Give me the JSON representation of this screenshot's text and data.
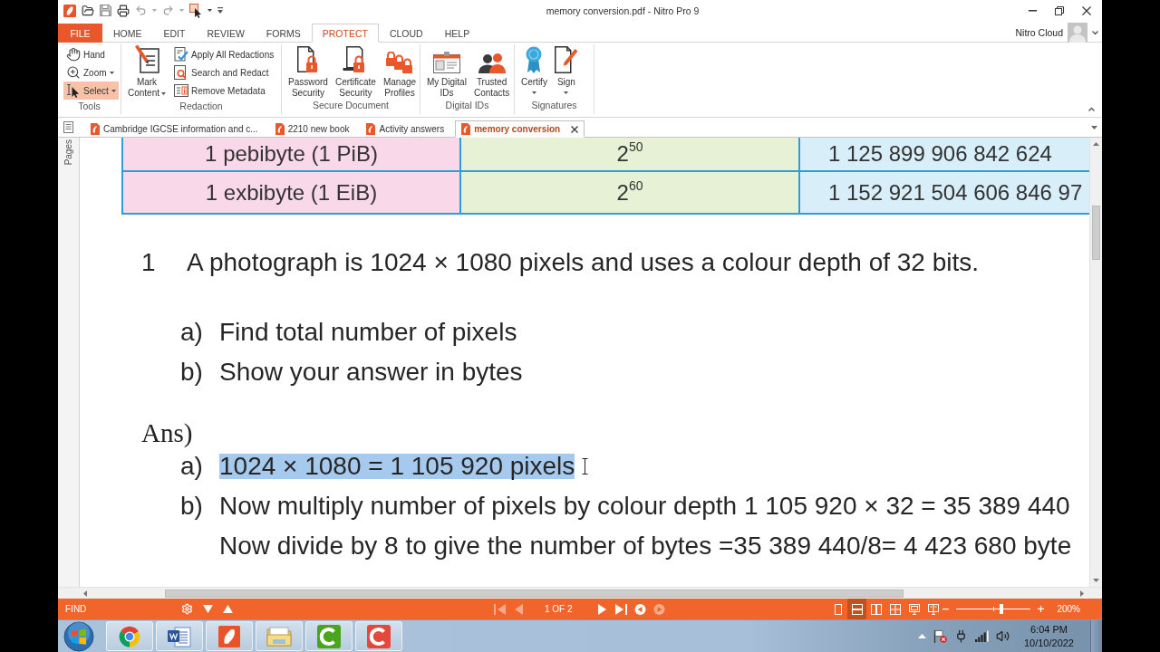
{
  "window": {
    "title": "memory conversion.pdf - Nitro Pro 9"
  },
  "ribbon_tabs": [
    {
      "label": "FILE",
      "kind": "file",
      "selected": false
    },
    {
      "label": "HOME",
      "kind": "tab",
      "selected": false
    },
    {
      "label": "EDIT",
      "kind": "tab",
      "selected": false
    },
    {
      "label": "REVIEW",
      "kind": "tab",
      "selected": false
    },
    {
      "label": "FORMS",
      "kind": "tab",
      "selected": false
    },
    {
      "label": "PROTECT",
      "kind": "tab",
      "selected": true
    },
    {
      "label": "CLOUD",
      "kind": "tab",
      "selected": false
    },
    {
      "label": "HELP",
      "kind": "tab",
      "selected": false
    }
  ],
  "account": {
    "label": "Nitro Cloud"
  },
  "ribbon_groups": [
    {
      "title": "Tools",
      "items": [
        {
          "label": "Hand",
          "kind": "small",
          "dropdown": false,
          "selected": false
        },
        {
          "label": "Zoom",
          "kind": "small",
          "dropdown": true,
          "selected": false
        },
        {
          "label": "Select",
          "kind": "small",
          "dropdown": true,
          "selected": true
        }
      ]
    },
    {
      "title": "Redaction",
      "items": [
        {
          "label": "Mark\nContent",
          "kind": "large",
          "dropdown": true
        },
        {
          "label": "Apply All Redactions",
          "kind": "small",
          "dropdown": false
        },
        {
          "label": "Search and Redact",
          "kind": "small",
          "dropdown": false
        },
        {
          "label": "Remove Metadata",
          "kind": "small",
          "dropdown": false
        }
      ]
    },
    {
      "title": "Secure Document",
      "items": [
        {
          "label": "Password\nSecurity",
          "kind": "large",
          "dropdown": false
        },
        {
          "label": "Certificate\nSecurity",
          "kind": "large",
          "dropdown": false
        },
        {
          "label": "Manage\nProfiles",
          "kind": "large",
          "dropdown": false
        }
      ]
    },
    {
      "title": "Digital IDs",
      "items": [
        {
          "label": "My Digital\nIDs",
          "kind": "large",
          "dropdown": false
        },
        {
          "label": "Trusted\nContacts",
          "kind": "large",
          "dropdown": false
        }
      ]
    },
    {
      "title": "Signatures",
      "items": [
        {
          "label": "Certify",
          "kind": "large",
          "dropdown": true
        },
        {
          "label": "Sign",
          "kind": "large",
          "dropdown": true
        }
      ]
    }
  ],
  "doc_tabs": [
    {
      "label": "Cambridge IGCSE information and c...",
      "selected": false
    },
    {
      "label": "2210 new book",
      "selected": false
    },
    {
      "label": "Activity answers",
      "selected": false
    },
    {
      "label": "memory conversion",
      "selected": true
    }
  ],
  "side_panel": {
    "label": "Pages"
  },
  "document": {
    "table_rows": [
      {
        "cells": [
          "1 pebibyte (1 PiB)",
          "2$^{50}$",
          "1 125 899 906 842 624"
        ]
      },
      {
        "cells": [
          "1 exbibyte (1 EiB)",
          "2$^{60}$",
          "1 152 921 504 606 846 97"
        ]
      }
    ],
    "question": {
      "number": "1",
      "text": "A photograph is 1024 × 1080 pixels and uses a colour depth of 32 bits."
    },
    "parts": [
      {
        "marker": "a)",
        "text": "Find total number of pixels"
      },
      {
        "marker": "b)",
        "text": "Show your answer in bytes"
      }
    ],
    "answer_heading": "Ans)",
    "answers": [
      {
        "marker": "a)",
        "text": "1024 × 1080 = 1 105 920 pixels",
        "selected": true
      },
      {
        "marker": "b)",
        "text": "Now multiply number of pixels by colour depth 1 105 920 × 32 = 35 389 440",
        "selected": false
      },
      {
        "text": "Now divide by 8 to give the number of bytes =35 389 440/8= 4 423 680 byte",
        "selected": false
      }
    ]
  },
  "status_bar": {
    "find_label": "FIND",
    "page_controls": [
      {
        "kind": "first",
        "disabled": true
      },
      {
        "kind": "previous",
        "disabled": true
      },
      {
        "kind": "indicator",
        "label": "1 OF 2"
      },
      {
        "kind": "next",
        "disabled": false
      },
      {
        "kind": "last",
        "disabled": false
      },
      {
        "kind": "back",
        "disabled": false
      },
      {
        "kind": "forward",
        "disabled": true
      }
    ],
    "view_modes": [
      {
        "kind": "single",
        "selected": false
      },
      {
        "kind": "continuous",
        "selected": true
      },
      {
        "kind": "facing",
        "selected": false
      },
      {
        "kind": "grid",
        "selected": false
      },
      {
        "kind": "monitor",
        "selected": false
      },
      {
        "kind": "monitor-split",
        "selected": false
      }
    ],
    "zoom": {
      "level": 0.6,
      "reading": "200%"
    }
  },
  "taskbar": {
    "time": "6:04 PM",
    "date": "10/10/2022"
  }
}
